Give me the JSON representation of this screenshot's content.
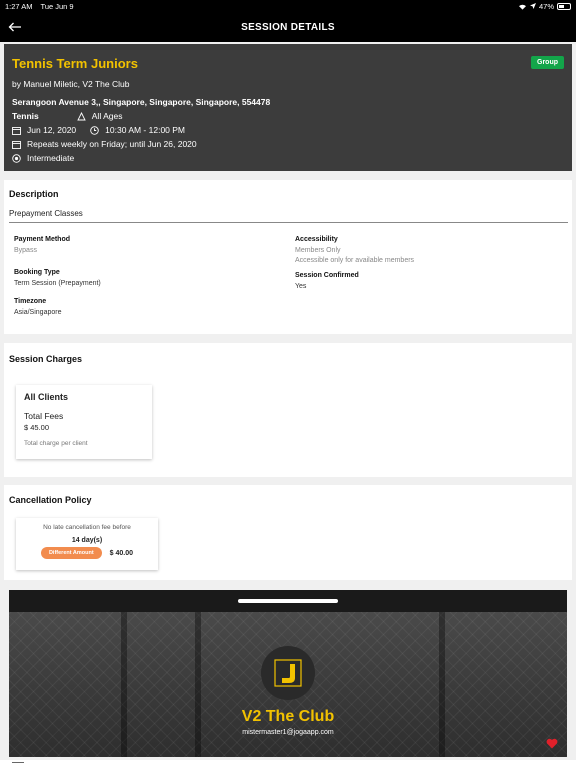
{
  "status_bar": {
    "time": "1:27 AM",
    "date": "Tue Jun 9",
    "battery": "47%"
  },
  "nav": {
    "title": "SESSION DETAILS"
  },
  "session": {
    "name": "Tennis Term Juniors",
    "badge": "Group",
    "host": "by Manuel Miletic, V2 The Club",
    "address": "Serangoon Avenue 3,, Singapore, Singapore, Singapore, 554478",
    "sport": "Tennis",
    "age": "All Ages",
    "date": "Jun 12, 2020",
    "time": "10:30 AM - 12:00 PM",
    "repeat": "Repeats weekly on Friday; until Jun 26, 2020",
    "level": "Intermediate"
  },
  "description": {
    "title": "Description",
    "subtitle": "Prepayment Classes",
    "payment_method_label": "Payment Method",
    "payment_method_value": "Bypass",
    "booking_type_label": "Booking Type",
    "booking_type_value": "Term Session (Prepayment)",
    "timezone_label": "Timezone",
    "timezone_value": "Asia/Singapore",
    "accessibility_label": "Accessibility",
    "accessibility_value": "Members Only",
    "accessibility_note": "Accessible only for available members",
    "confirmed_label": "Session Confirmed",
    "confirmed_value": "Yes"
  },
  "charges": {
    "title": "Session Charges",
    "box_title": "All Clients",
    "fee_label": "Total Fees",
    "fee_amount": "$ 45.00",
    "fee_note": "Total charge per client"
  },
  "cancellation": {
    "title": "Cancellation Policy",
    "note": "No late cancellation fee before",
    "days": "14 day(s)",
    "pill": "Different Amount",
    "amount": "$ 40.00"
  },
  "club": {
    "name": "V2 The Club",
    "email": "mistermaster1@jogaapp.com"
  },
  "colors": {
    "accent": "#f2c200",
    "badge": "#13a54a",
    "pill": "#f28c4e",
    "heart": "#e0202a"
  }
}
